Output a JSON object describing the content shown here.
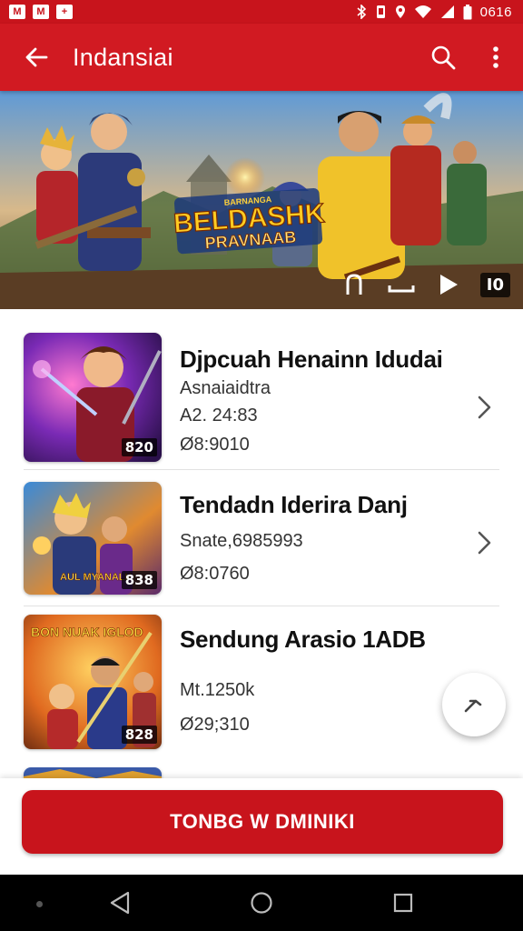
{
  "status_bar": {
    "time": "0616",
    "notifications": [
      "M",
      "M",
      "+"
    ],
    "icons": [
      "bluetooth-icon",
      "vibrate-icon",
      "location-icon",
      "wifi-icon",
      "signal-icon",
      "battery-icon"
    ]
  },
  "app_bar": {
    "title": "Indansiai",
    "back_icon": "arrow-back-icon",
    "search_icon": "search-icon",
    "menu_icon": "more-vert-icon"
  },
  "hero": {
    "logo_line1": "BELDASHK",
    "logo_line2": "PRAVNAAB",
    "logo_top": "BARNANGA",
    "count": "I0"
  },
  "items": [
    {
      "title": "Djpcuah Henainn Idudai",
      "lines": [
        "Asnaiaidtra",
        "A2. 24:83",
        "Ø8:9010"
      ],
      "badge": "820",
      "action_icon": "chevron-right-icon"
    },
    {
      "title": "Tendadn Iderira Danj",
      "lines": [
        "Snate,6985993",
        "Ø8:0760"
      ],
      "badge": "838",
      "action_icon": "chevron-right-icon",
      "thumb_text": "AUL MYANALK"
    },
    {
      "title": "Sendung Arasio 1ADB",
      "lines": [
        "Mt.1250k",
        "Ø29;310"
      ],
      "badge": "828",
      "thumb_text": "BON NUAK IGLOD"
    }
  ],
  "fab": {
    "icon": "edit-arrow-icon"
  },
  "cta": {
    "label": "TONBG W DMINIKI"
  },
  "colors": {
    "primary": "#d11a22",
    "primary_dark": "#c8141c",
    "nav_bar": "#000000"
  }
}
